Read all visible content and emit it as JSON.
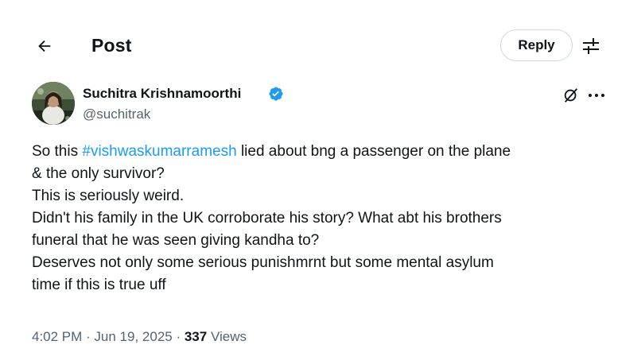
{
  "header": {
    "title": "Post",
    "reply_label": "Reply",
    "back_icon": "arrow-left-icon",
    "filter_icon": "sliders-icon"
  },
  "author": {
    "name": "Suchitra Krishnamoorthi",
    "handle": "@suchitrak",
    "verified": true,
    "avatar_icon": "profile-photo"
  },
  "actions": {
    "grok_icon": "grok-icon",
    "more_icon": "more-dots-icon"
  },
  "tweet": {
    "line1_prefix": "So this ",
    "hashtag": "#vishwaskumarramesh",
    "line1_suffix": " lied about bng a passenger on the plane",
    "line2": "& the only survivor?",
    "line3": "This is seriously weird.",
    "line4": "Didn't his family in the UK corroborate his story? What abt his brothers",
    "line5": "funeral that he was seen giving kandha to?",
    "line6": "Deserves not only some serious punishmrnt but some mental asylum",
    "line7": "time if this is true uff"
  },
  "meta": {
    "time": "4:02 PM",
    "sep1": " · ",
    "date": "Jun 19, 2025",
    "sep2": " · ",
    "views_count": "337",
    "views_label": " Views"
  },
  "colors": {
    "text": "#0f1419",
    "secondary": "#536471",
    "link": "#1d9bf0",
    "border": "#cfd9de"
  }
}
